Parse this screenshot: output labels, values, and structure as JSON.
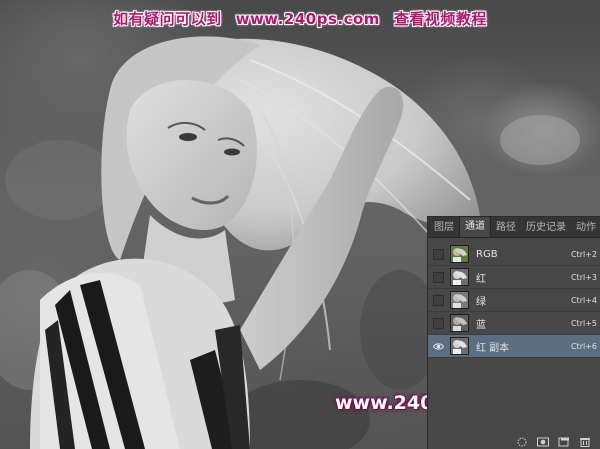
{
  "watermark_top": {
    "prefix": "如有疑问可以到",
    "url": "www.240ps.com",
    "suffix": "查看视频教程"
  },
  "watermark_bottom": "www.240ps.com",
  "panel": {
    "tabs": [
      {
        "label": "图层",
        "active": false
      },
      {
        "label": "通道",
        "active": true
      },
      {
        "label": "路径",
        "active": false
      },
      {
        "label": "历史记录",
        "active": false
      },
      {
        "label": "动作",
        "active": false
      }
    ],
    "channels": [
      {
        "name": "RGB",
        "shortcut": "Ctrl+2",
        "visible": false,
        "selected": false
      },
      {
        "name": "红",
        "shortcut": "Ctrl+3",
        "visible": false,
        "selected": false
      },
      {
        "name": "绿",
        "shortcut": "Ctrl+4",
        "visible": false,
        "selected": false
      },
      {
        "name": "蓝",
        "shortcut": "Ctrl+5",
        "visible": false,
        "selected": false
      },
      {
        "name": "红 副本",
        "shortcut": "Ctrl+6",
        "visible": true,
        "selected": true
      }
    ],
    "footer_icons": [
      "load-selection-icon",
      "save-selection-icon",
      "new-channel-icon",
      "delete-channel-icon"
    ]
  },
  "colors": {
    "watermark": "#b5166d",
    "panel_bg": "#474747",
    "selected_row": "#5b6d80"
  }
}
